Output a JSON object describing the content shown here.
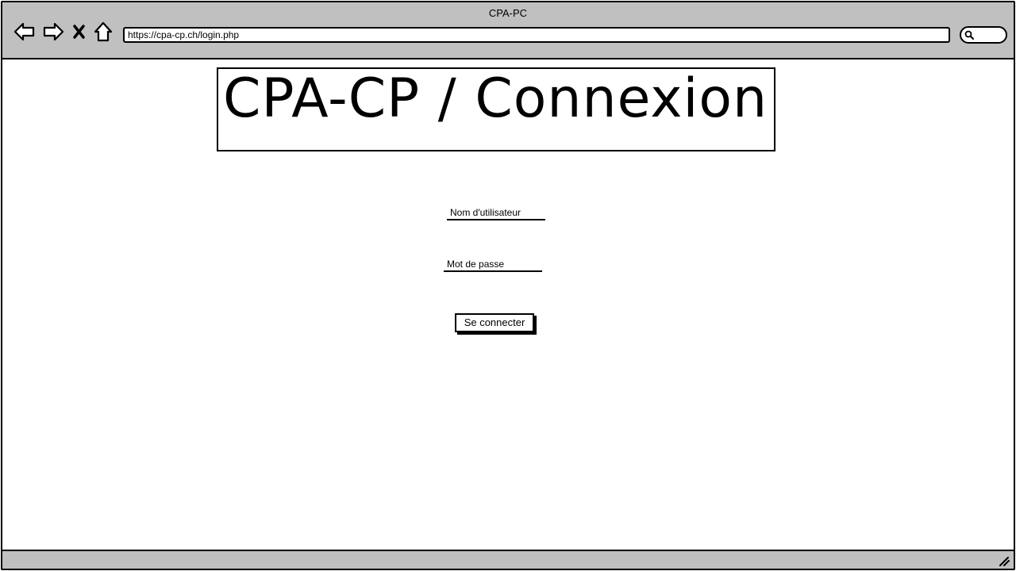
{
  "window": {
    "title": "CPA-PC"
  },
  "browser": {
    "url": "https://cpa-cp.ch/login.php",
    "buttons": {
      "back": "back-arrow-icon",
      "forward": "forward-arrow-icon",
      "stop": "close-icon",
      "home": "home-icon"
    },
    "search_icon": "search-icon"
  },
  "page": {
    "heading": "CPA-CP / Connexion",
    "form": {
      "username_label": "Nom d'utilisateur",
      "password_label": "Mot de passe",
      "submit_label": "Se connecter"
    }
  },
  "colors": {
    "chrome": "#c0c0c0",
    "ink": "#000000",
    "background": "#ffffff"
  }
}
